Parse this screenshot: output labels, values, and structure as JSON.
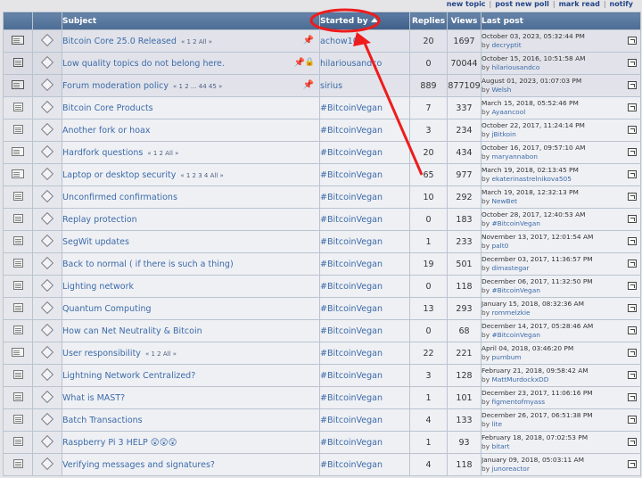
{
  "top_links": [
    "new topic",
    "post new poll",
    "mark read",
    "notify"
  ],
  "headers": {
    "subject": "Subject",
    "started_by": "Started by",
    "replies": "Replies",
    "views": "Views",
    "last_post": "Last post"
  },
  "annotation": {
    "color": "#ee1c1c"
  },
  "topics": [
    {
      "subject": "Bitcoin Core 25.0 Released",
      "pages": "« 1 2  All »",
      "starter": "achow101",
      "replies": "20",
      "views": "1697",
      "last_date": "October 03, 2023, 05:32:44 PM",
      "last_by": "by",
      "last_user": "decryptit",
      "sticky": true,
      "locked": false
    },
    {
      "subject": "Low quality topics do not belong here.",
      "pages": "",
      "starter": "hilariousandco",
      "replies": "0",
      "views": "70044",
      "last_date": "October 15, 2016, 10:51:58 AM",
      "last_by": "by",
      "last_user": "hilariousandco",
      "sticky": true,
      "locked": true
    },
    {
      "subject": "Forum moderation policy",
      "pages": "« 1 2 ... 44 45 »",
      "starter": "sirius",
      "replies": "889",
      "views": "877109",
      "last_date": "August 01, 2023, 01:07:03 PM",
      "last_by": "by",
      "last_user": "Welsh",
      "sticky": true,
      "locked": false
    },
    {
      "subject": "Bitcoin Core Products",
      "pages": "",
      "starter": "#BitcoinVegan",
      "replies": "7",
      "views": "337",
      "last_date": "March 15, 2018, 05:52:46 PM",
      "last_by": "by",
      "last_user": "Ayaancool",
      "sticky": false,
      "locked": false
    },
    {
      "subject": "Another fork or hoax",
      "pages": "",
      "starter": "#BitcoinVegan",
      "replies": "3",
      "views": "234",
      "last_date": "October 22, 2017, 11:24:14 PM",
      "last_by": "by",
      "last_user": "jBitkoin",
      "sticky": false,
      "locked": false
    },
    {
      "subject": "Hardfork questions",
      "pages": "« 1 2  All »",
      "starter": "#BitcoinVegan",
      "replies": "20",
      "views": "434",
      "last_date": "October 16, 2017, 09:57:10 AM",
      "last_by": "by",
      "last_user": "maryannabon",
      "sticky": false,
      "locked": false
    },
    {
      "subject": "Laptop or desktop security",
      "pages": "« 1 2 3 4  All »",
      "starter": "#BitcoinVegan",
      "replies": "65",
      "views": "977",
      "last_date": "March 19, 2018, 02:13:45 PM",
      "last_by": "by",
      "last_user": "ekaterinastrelnikova505",
      "sticky": false,
      "locked": false
    },
    {
      "subject": "Unconfirmed confirmations",
      "pages": "",
      "starter": "#BitcoinVegan",
      "replies": "10",
      "views": "292",
      "last_date": "March 19, 2018, 12:32:13 PM",
      "last_by": "by",
      "last_user": "NewBet",
      "sticky": false,
      "locked": false
    },
    {
      "subject": "Replay protection",
      "pages": "",
      "starter": "#BitcoinVegan",
      "replies": "0",
      "views": "183",
      "last_date": "October 28, 2017, 12:40:53 AM",
      "last_by": "by",
      "last_user": "#BitcoinVegan",
      "sticky": false,
      "locked": false
    },
    {
      "subject": "SegWit updates",
      "pages": "",
      "starter": "#BitcoinVegan",
      "replies": "1",
      "views": "233",
      "last_date": "November 13, 2017, 12:01:54 AM",
      "last_by": "by",
      "last_user": "palt0",
      "sticky": false,
      "locked": false
    },
    {
      "subject": "Back to normal ( if there is such a thing)",
      "pages": "",
      "starter": "#BitcoinVegan",
      "replies": "19",
      "views": "501",
      "last_date": "December 03, 2017, 11:36:57 PM",
      "last_by": "by",
      "last_user": "dimastegar",
      "sticky": false,
      "locked": false
    },
    {
      "subject": "Lighting network",
      "pages": "",
      "starter": "#BitcoinVegan",
      "replies": "0",
      "views": "118",
      "last_date": "December 06, 2017, 11:32:50 PM",
      "last_by": "by",
      "last_user": "#BitcoinVegan",
      "sticky": false,
      "locked": false
    },
    {
      "subject": "Quantum Computing",
      "pages": "",
      "starter": "#BitcoinVegan",
      "replies": "13",
      "views": "293",
      "last_date": "January 15, 2018, 08:32:36 AM",
      "last_by": "by",
      "last_user": "rommelzkie",
      "sticky": false,
      "locked": false
    },
    {
      "subject": "How can Net Neutrality & Bitcoin",
      "pages": "",
      "starter": "#BitcoinVegan",
      "replies": "0",
      "views": "68",
      "last_date": "December 14, 2017, 05:28:46 AM",
      "last_by": "by",
      "last_user": "#BitcoinVegan",
      "sticky": false,
      "locked": false
    },
    {
      "subject": "User responsibility",
      "pages": "« 1 2  All »",
      "starter": "#BitcoinVegan",
      "replies": "22",
      "views": "221",
      "last_date": "April 04, 2018, 03:46:20 PM",
      "last_by": "by",
      "last_user": "pumbum",
      "sticky": false,
      "locked": false
    },
    {
      "subject": "Lightning Network Centralized?",
      "pages": "",
      "starter": "#BitcoinVegan",
      "replies": "3",
      "views": "128",
      "last_date": "February 21, 2018, 09:58:42 AM",
      "last_by": "by",
      "last_user": "MattMurdockxDD",
      "sticky": false,
      "locked": false
    },
    {
      "subject": "What is MAST?",
      "pages": "",
      "starter": "#BitcoinVegan",
      "replies": "1",
      "views": "101",
      "last_date": "December 23, 2017, 11:06:16 PM",
      "last_by": "by",
      "last_user": "figmentofmyass",
      "sticky": false,
      "locked": false
    },
    {
      "subject": "Batch Transactions",
      "pages": "",
      "starter": "#BitcoinVegan",
      "replies": "4",
      "views": "133",
      "last_date": "December 26, 2017, 06:51:38 PM",
      "last_by": "by",
      "last_user": "lite",
      "sticky": false,
      "locked": false
    },
    {
      "subject": "Raspberry Pi 3 HELP 😲😲😲",
      "pages": "",
      "starter": "#BitcoinVegan",
      "replies": "1",
      "views": "93",
      "last_date": "February 18, 2018, 07:02:53 PM",
      "last_by": "by",
      "last_user": "bitart",
      "sticky": false,
      "locked": false
    },
    {
      "subject": "Verifying messages and signatures?",
      "pages": "",
      "starter": "#BitcoinVegan",
      "replies": "4",
      "views": "118",
      "last_date": "January 09, 2018, 05:03:11 AM",
      "last_by": "by",
      "last_user": "junoreactor",
      "sticky": false,
      "locked": false
    }
  ]
}
